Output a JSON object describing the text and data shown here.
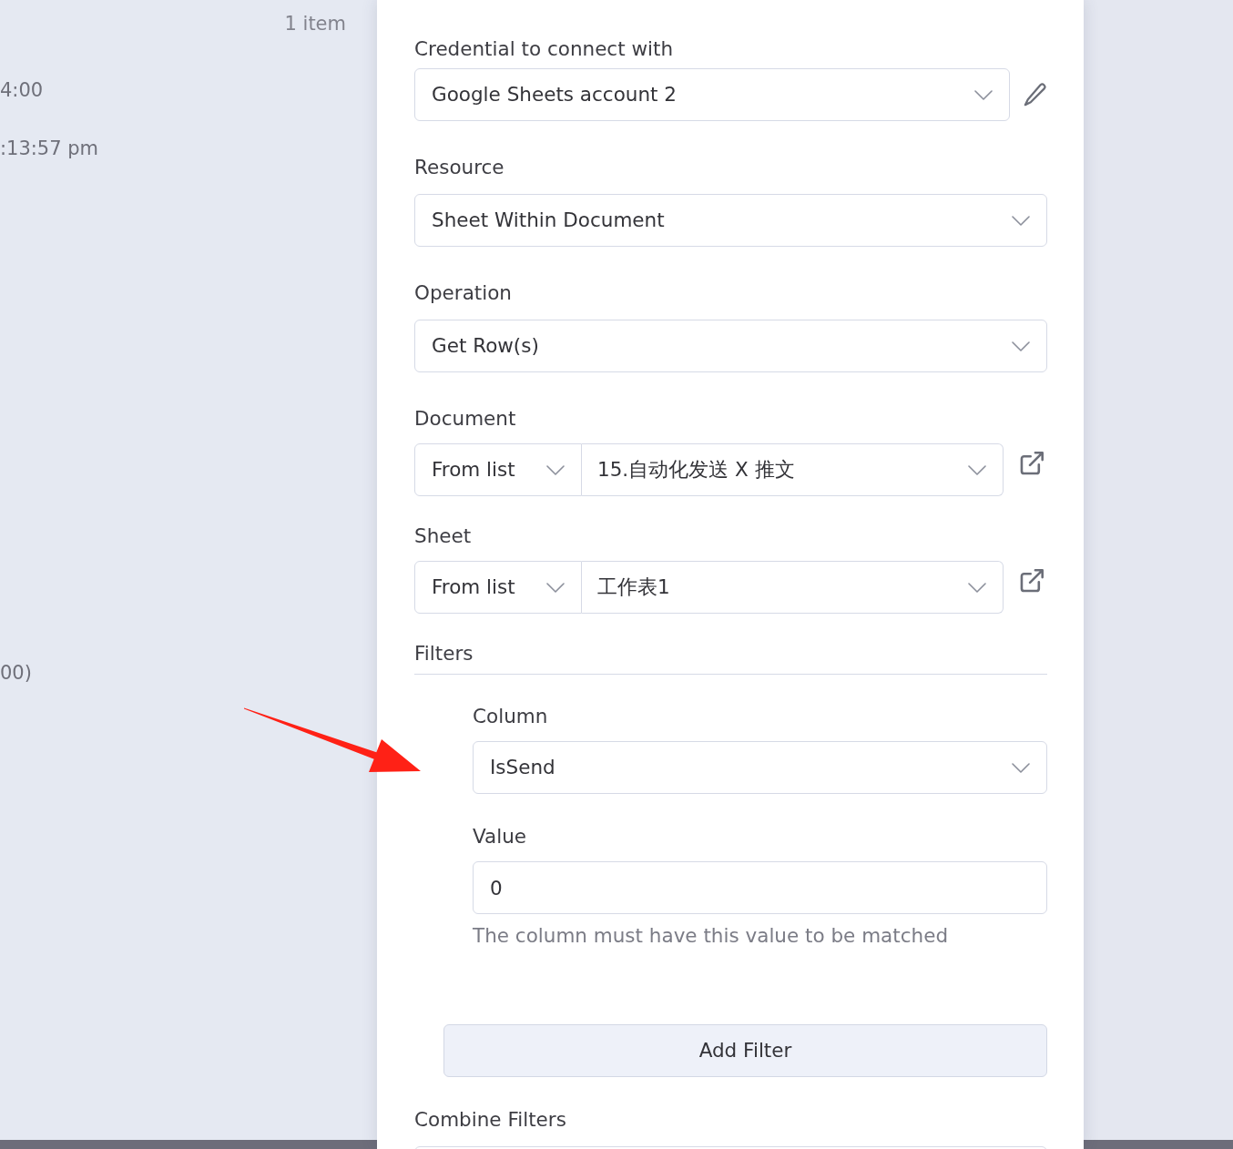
{
  "background_panel": {
    "item_count": "1 item",
    "lines": [
      "4:00",
      ":13:57 pm",
      "00)"
    ]
  },
  "parameters": [
    {
      "kind": "select",
      "label": "Credential to connect with",
      "value": "Google Sheets account 2",
      "editable": true
    },
    {
      "kind": "select",
      "label": "Resource",
      "value": "Sheet Within Document"
    },
    {
      "kind": "select",
      "label": "Operation",
      "value": "Get Row(s)"
    },
    {
      "kind": "resource_locator",
      "label": "Document",
      "mode": "From list",
      "value": "15.自动化发送 X 推文",
      "external_link": true
    },
    {
      "kind": "resource_locator",
      "label": "Sheet",
      "mode": "From list",
      "value": "工作表1",
      "external_link": true
    },
    {
      "kind": "collection",
      "label": "Filters",
      "items": [
        {
          "kind": "select",
          "label": "Column",
          "value": "IsSend"
        },
        {
          "kind": "input",
          "label": "Value",
          "value": "0",
          "hint": "The column must have this value to be matched"
        }
      ],
      "button": "Add Filter"
    },
    {
      "kind": "select",
      "label": "Combine Filters"
    }
  ],
  "annotations": [
    {
      "kind": "arrow"
    }
  ]
}
